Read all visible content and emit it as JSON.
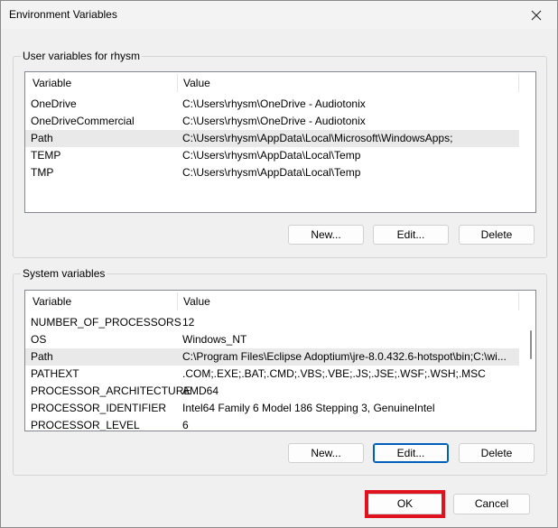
{
  "window": {
    "title": "Environment Variables"
  },
  "user_group": {
    "label": "User variables for rhysm",
    "columns": [
      "Variable",
      "Value"
    ],
    "rows": [
      {
        "variable": "OneDrive",
        "value": "C:\\Users\\rhysm\\OneDrive - Audiotonix"
      },
      {
        "variable": "OneDriveCommercial",
        "value": "C:\\Users\\rhysm\\OneDrive - Audiotonix"
      },
      {
        "variable": "Path",
        "value": "C:\\Users\\rhysm\\AppData\\Local\\Microsoft\\WindowsApps;"
      },
      {
        "variable": "TEMP",
        "value": "C:\\Users\\rhysm\\AppData\\Local\\Temp"
      },
      {
        "variable": "TMP",
        "value": "C:\\Users\\rhysm\\AppData\\Local\\Temp"
      }
    ],
    "selected_index": 2,
    "buttons": {
      "new": "New...",
      "edit": "Edit...",
      "delete": "Delete"
    }
  },
  "system_group": {
    "label": "System variables",
    "columns": [
      "Variable",
      "Value"
    ],
    "rows": [
      {
        "variable": "NUMBER_OF_PROCESSORS",
        "value": "12"
      },
      {
        "variable": "OS",
        "value": "Windows_NT"
      },
      {
        "variable": "Path",
        "value": "C:\\Program Files\\Eclipse Adoptium\\jre-8.0.432.6-hotspot\\bin;C:\\wi..."
      },
      {
        "variable": "PATHEXT",
        "value": ".COM;.EXE;.BAT;.CMD;.VBS;.VBE;.JS;.JSE;.WSF;.WSH;.MSC"
      },
      {
        "variable": "PROCESSOR_ARCHITECTURE",
        "value": "AMD64"
      },
      {
        "variable": "PROCESSOR_IDENTIFIER",
        "value": "Intel64 Family 6 Model 186 Stepping 3, GenuineIntel"
      },
      {
        "variable": "PROCESSOR_LEVEL",
        "value": "6"
      }
    ],
    "selected_index": 2,
    "buttons": {
      "new": "New...",
      "edit": "Edit...",
      "delete": "Delete"
    }
  },
  "footer": {
    "ok": "OK",
    "cancel": "Cancel"
  },
  "icons": {
    "close": "close-icon"
  },
  "colors": {
    "highlight": "#e0121f",
    "focus": "#005fb8",
    "selection": "#e9e9e9"
  }
}
